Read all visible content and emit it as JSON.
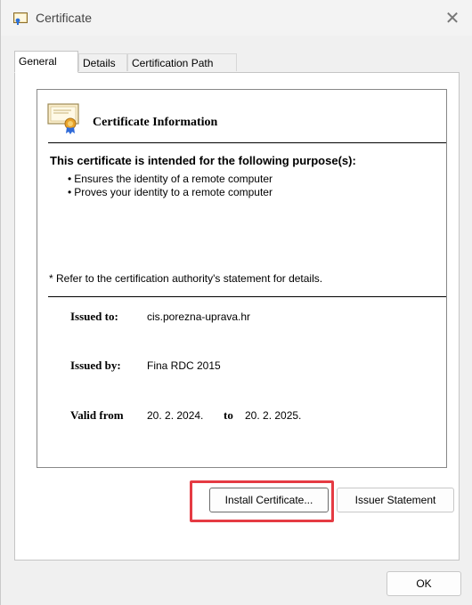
{
  "window": {
    "title": "Certificate"
  },
  "tabs": [
    {
      "label": "General",
      "active": true
    },
    {
      "label": "Details",
      "active": false
    },
    {
      "label": "Certification Path",
      "active": false
    }
  ],
  "info": {
    "heading": "Certificate Information",
    "purpose_heading": "This certificate is intended for the following purpose(s):",
    "purposes": [
      "Ensures the identity of a remote computer",
      "Proves your identity to a remote computer"
    ],
    "refer_note": "* Refer to the certification authority's statement for details.",
    "issued_to_label": "Issued to:",
    "issued_to": "cis.porezna-uprava.hr",
    "issued_by_label": "Issued by:",
    "issued_by": "Fina RDC 2015",
    "valid_from_label": "Valid from",
    "valid_from": "20. 2. 2024.",
    "to_label": "to",
    "valid_to": "20. 2. 2025."
  },
  "buttons": {
    "install_certificate": "Install Certificate...",
    "issuer_statement": "Issuer Statement",
    "ok": "OK"
  },
  "colors": {
    "highlight": "#e53b43",
    "dialog_bg": "#f0f0f0"
  }
}
